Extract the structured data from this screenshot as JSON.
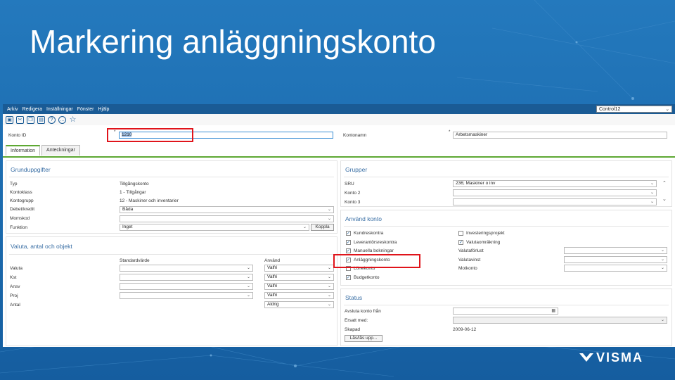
{
  "slide": {
    "title": "Markering anläggningskonto",
    "brand": "VISMA"
  },
  "menu": [
    "Arkiv",
    "Redigera",
    "Inställningar",
    "Fönster",
    "Hjälp"
  ],
  "company_select": "Control12",
  "toolbar_icons": [
    "save-icon",
    "cut-icon",
    "copy-icon",
    "paste-icon",
    "help-icon",
    "comment-icon",
    "favorite-icon"
  ],
  "header": {
    "konto_id_label": "Konto ID",
    "konto_id_value": "1210",
    "kontonamn_label": "Kontonamn",
    "kontonamn_value": "Arbetsmaskiner",
    "required": "*"
  },
  "tabs": [
    "Information",
    "Anteckningar"
  ],
  "grund": {
    "title": "Grunduppgifter",
    "rows": [
      {
        "label": "Typ",
        "value": "Tillgångskonto"
      },
      {
        "label": "Kontoklass",
        "value": "1  -  Tillgångar"
      },
      {
        "label": "Kontogrupp",
        "value": "12  -  Maskiner och inventarier"
      },
      {
        "label": "Debet/kredit",
        "value": "Båda"
      },
      {
        "label": "Momskod",
        "value": ""
      },
      {
        "label": "Funktion",
        "value": "Inget"
      }
    ],
    "koppla": "Koppla"
  },
  "valuta": {
    "title": "Valuta, antal och objekt",
    "col_std": "Standardvärde",
    "col_anvand": "Använd",
    "rows": [
      {
        "label": "Valuta",
        "use": "Valfri"
      },
      {
        "label": "Kst",
        "use": "Valfri"
      },
      {
        "label": "Ansv",
        "use": "Valfri"
      },
      {
        "label": "Proj",
        "use": "Valfri"
      },
      {
        "label": "Antal",
        "use": "Aldrig"
      }
    ]
  },
  "grupper": {
    "title": "Grupper",
    "rows": [
      {
        "label": "SRU",
        "value": "236; Maskiner o inv"
      },
      {
        "label": "Konto 2",
        "value": ""
      },
      {
        "label": "Konto 3",
        "value": ""
      }
    ]
  },
  "anvand": {
    "title": "Använd konto",
    "left": [
      {
        "label": "Kundreskontra",
        "checked": true
      },
      {
        "label": "Leverantörsreskontra",
        "checked": true
      },
      {
        "label": "Manuella bokningar",
        "checked": true
      },
      {
        "label": "Anläggningskonto",
        "checked": true
      },
      {
        "label": "Lönekonto",
        "checked": false
      },
      {
        "label": "Budgetkonto",
        "checked": true
      }
    ],
    "right_checks": [
      {
        "label": "Investeringsprojekt",
        "checked": false
      },
      {
        "label": "Valutaomräkning",
        "checked": true
      }
    ],
    "right_fields": [
      "Valutaförlust",
      "Valutavinst",
      "Motkonto"
    ]
  },
  "status": {
    "title": "Status",
    "avsluta_label": "Avsluta konto från",
    "ersatt_label": "Ersatt med:",
    "skapad_label": "Skapad",
    "skapad_value": "2009-06-12",
    "las_button": "Lås/lås upp..."
  }
}
